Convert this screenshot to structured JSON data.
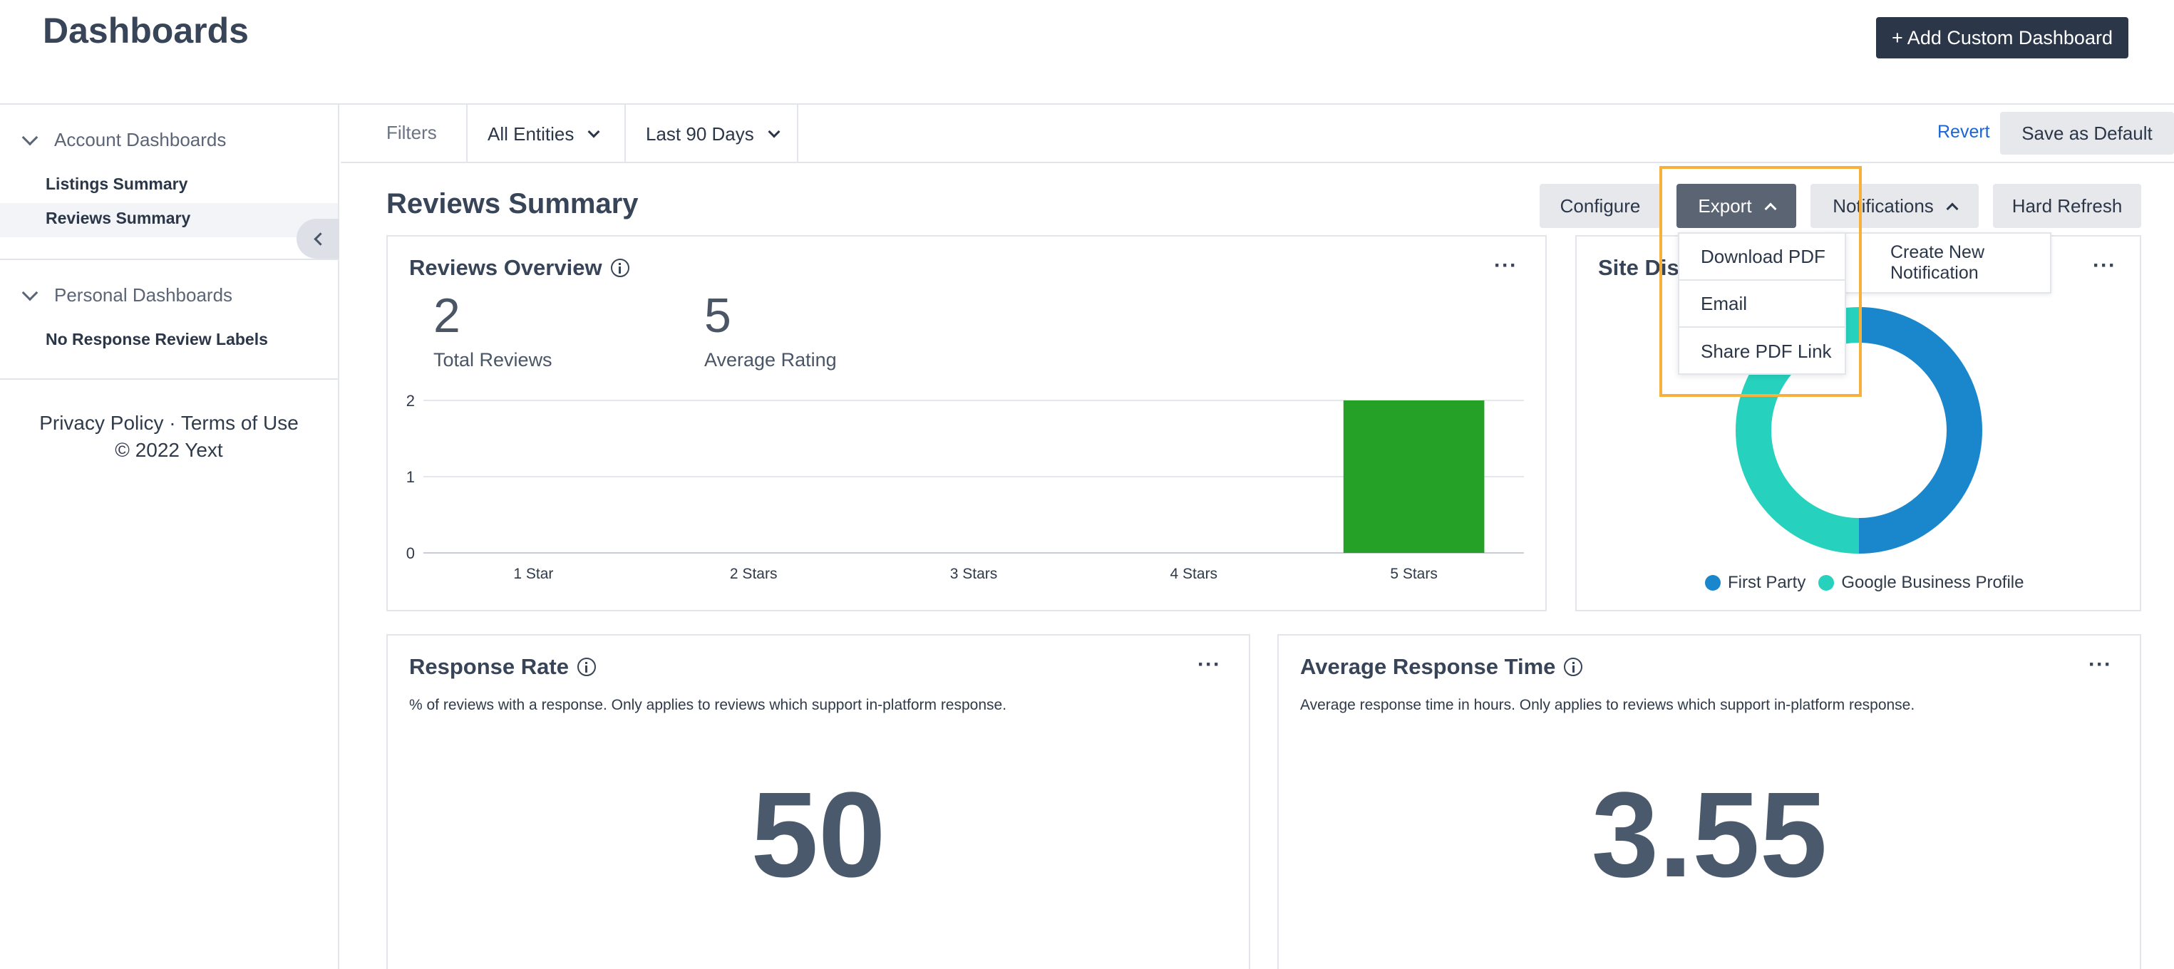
{
  "header": {
    "title": "Dashboards",
    "add_button": "+ Add Custom Dashboard"
  },
  "sidebar": {
    "groups": [
      {
        "label": "Account Dashboards",
        "items": [
          "Listings Summary",
          "Reviews Summary"
        ]
      },
      {
        "label": "Personal Dashboards",
        "items": [
          "No Response Review Labels"
        ]
      }
    ],
    "active_item": "Reviews Summary",
    "footer": {
      "privacy": "Privacy Policy",
      "separator": "·",
      "terms": "Terms of Use",
      "copyright": "© 2022 Yext"
    }
  },
  "filters": {
    "label": "Filters",
    "entities": "All Entities",
    "date_range": "Last 90 Days",
    "revert": "Revert",
    "save_default": "Save as Default"
  },
  "section": {
    "title": "Reviews Summary",
    "configure": "Configure",
    "export": "Export",
    "notifications": "Notifications",
    "hard_refresh": "Hard Refresh"
  },
  "export_menu": [
    "Download PDF",
    "Email",
    "Share PDF Link"
  ],
  "notifications_menu": [
    "Create New Notification"
  ],
  "reviews_overview": {
    "title": "Reviews Overview",
    "total_reviews": "2",
    "total_reviews_label": "Total Reviews",
    "average_rating": "5",
    "average_rating_label": "Average Rating"
  },
  "site_distribution": {
    "title": "Site Dis"
  },
  "response_rate": {
    "title": "Response Rate",
    "description": "% of reviews with a response. Only applies to reviews which support in-platform response.",
    "value": "50"
  },
  "avg_response_time": {
    "title": "Average Response Time",
    "description": "Average response time in hours. Only applies to reviews which support in-platform response.",
    "value": "3.55"
  },
  "colors": {
    "bar": "#26a128",
    "first_party": "#1a87cc",
    "google": "#26d1bd",
    "highlight": "#f6b13c"
  },
  "chart_data": [
    {
      "type": "bar",
      "categories": [
        "1 Star",
        "2 Stars",
        "3 Stars",
        "4 Stars",
        "5 Stars"
      ],
      "values": [
        0,
        0,
        0,
        0,
        2
      ],
      "yticks": [
        "0",
        "1",
        "2"
      ],
      "ylim": [
        0,
        2
      ]
    },
    {
      "type": "pie",
      "donut": true,
      "labels": [
        "First Party",
        "Google Business Profile"
      ],
      "values": [
        50,
        50
      ],
      "legend": "bottom"
    }
  ]
}
